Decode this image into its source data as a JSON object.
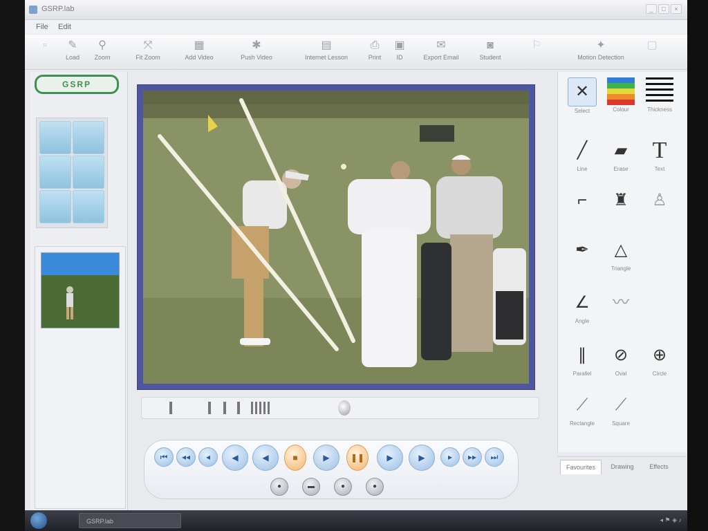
{
  "window": {
    "title": "GSRP.lab",
    "controls": [
      "_",
      "□",
      "×"
    ]
  },
  "menu": [
    "File",
    "Edit"
  ],
  "toolbar": [
    {
      "label": "",
      "icon": "new-icon",
      "disabled": true
    },
    {
      "label": "Load",
      "icon": "load-icon"
    },
    {
      "label": "Zoom",
      "icon": "zoom-icon"
    },
    {
      "label": "Fit Zoom",
      "icon": "fit-zoom-icon"
    },
    {
      "label": "Add Video",
      "icon": "add-video-icon"
    },
    {
      "label": "Push Video",
      "icon": "push-video-icon"
    },
    {
      "label": "Internet Lesson",
      "icon": "internet-lesson-icon"
    },
    {
      "label": "Print",
      "icon": "print-icon"
    },
    {
      "label": "ID",
      "icon": "id-icon"
    },
    {
      "label": "Export Email",
      "icon": "export-email-icon"
    },
    {
      "label": "Student",
      "icon": "student-icon"
    },
    {
      "label": "",
      "icon": "disabled-tool-icon",
      "disabled": true
    },
    {
      "label": "Motion Detection",
      "icon": "motion-detection-icon"
    },
    {
      "label": "",
      "icon": "camera-icon",
      "disabled": true
    }
  ],
  "left_panel": {
    "logo": "GSRP",
    "thumbnail": {
      "heading": ""
    }
  },
  "right_panel": {
    "tools": [
      {
        "label": "Select",
        "icon": "select-icon",
        "selected": true
      },
      {
        "label": "Colour",
        "icon": "color-palette-icon"
      },
      {
        "label": "Thickness",
        "icon": "line-thickness-icon"
      },
      {
        "label": "Line",
        "icon": "line-icon"
      },
      {
        "label": "Erase",
        "icon": "eraser-icon"
      },
      {
        "label": "Text",
        "icon": "text-icon"
      },
      {
        "label": "",
        "icon": "freehand-icon"
      },
      {
        "label": "",
        "icon": "golfer-icon"
      },
      {
        "label": "",
        "icon": "body-outline-icon"
      },
      {
        "label": "",
        "icon": "pen-icon"
      },
      {
        "label": "Triangle",
        "icon": "triangle-icon"
      },
      {
        "label": "",
        "icon": "empty"
      },
      {
        "label": "Angle",
        "icon": "angle-icon"
      },
      {
        "label": "",
        "icon": "polyline-icon"
      },
      {
        "label": "",
        "icon": "empty"
      },
      {
        "label": "Parallel",
        "icon": "parallel-lines-icon"
      },
      {
        "label": "Oval",
        "icon": "oval-icon"
      },
      {
        "label": "Circle",
        "icon": "circle-icon"
      },
      {
        "label": "Rectangle",
        "icon": "rectangle-icon"
      },
      {
        "label": "Square",
        "icon": "square-icon"
      }
    ]
  },
  "tabs": [
    {
      "label": "Favourites",
      "active": true
    },
    {
      "label": "Drawing"
    },
    {
      "label": "Effects"
    }
  ],
  "transport": {
    "row1": [
      {
        "icon": "go-start-icon",
        "glyph": "⏮"
      },
      {
        "icon": "step-back-icon",
        "glyph": "◂◂"
      },
      {
        "icon": "frame-back-icon",
        "glyph": "◂"
      },
      {
        "icon": "rewind-icon",
        "glyph": "◀"
      },
      {
        "icon": "play-reverse-icon",
        "glyph": "◀"
      },
      {
        "icon": "stop-icon",
        "glyph": "■",
        "orange": true
      },
      {
        "icon": "play-icon",
        "glyph": "▶"
      },
      {
        "icon": "pause-icon",
        "glyph": "❚❚",
        "orange": true
      },
      {
        "icon": "fast-forward-icon",
        "glyph": "▶"
      },
      {
        "icon": "play-forward-icon",
        "glyph": "▶"
      },
      {
        "icon": "frame-forward-icon",
        "glyph": "▸"
      },
      {
        "icon": "step-forward-icon",
        "glyph": "▸▸"
      },
      {
        "icon": "go-end-icon",
        "glyph": "⏭"
      }
    ],
    "row2": [
      {
        "icon": "record-icon",
        "glyph": "●"
      },
      {
        "icon": "loop-icon",
        "glyph": "▬"
      },
      {
        "icon": "slow-icon",
        "glyph": "●"
      },
      {
        "icon": "marker-icon",
        "glyph": "●"
      }
    ],
    "speed_label": ""
  },
  "taskbar": {
    "item": "GSRP.lab"
  },
  "colors": {
    "video_frame": "#5055a0",
    "logo_green": "#3f8f52",
    "accent_blue": "#3b89d9"
  }
}
